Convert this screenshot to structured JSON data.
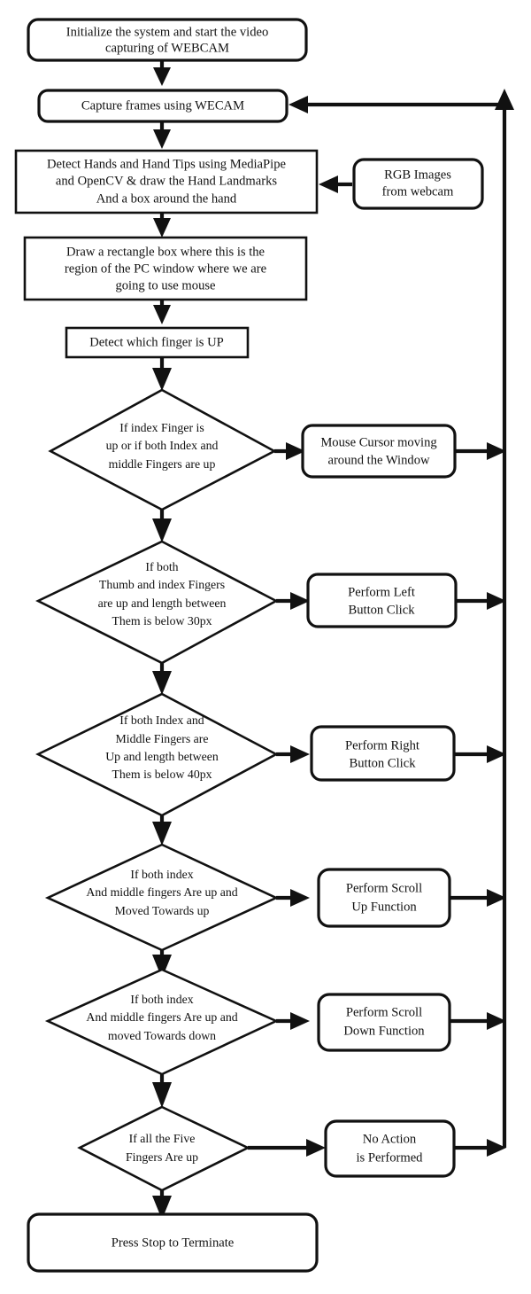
{
  "diagram": {
    "type": "flowchart",
    "title": "Virtual Mouse Hand Gesture Flowchart",
    "colors": {
      "stroke": "#111111",
      "fill": "#ffffff",
      "background": "#ffffff"
    },
    "nodes": [
      {
        "id": "start",
        "shape": "rounded-rect",
        "lines": [
          "Initialize the system and start the video",
          "capturing of WEBCAM"
        ]
      },
      {
        "id": "capture",
        "shape": "rounded-rect",
        "lines": [
          "Capture frames using WECAM"
        ]
      },
      {
        "id": "detect-hands",
        "shape": "rect",
        "lines": [
          "Detect Hands and Hand Tips using MediaPipe",
          "and OpenCV & draw the Hand Landmarks",
          "And a box around the hand"
        ]
      },
      {
        "id": "rgb-images",
        "shape": "rounded-rect",
        "lines": [
          "RGB Images",
          "from webcam"
        ]
      },
      {
        "id": "draw-rectangle",
        "shape": "rect",
        "lines": [
          "Draw a rectangle box where this is the",
          "region of the PC window where we are",
          "going to use mouse"
        ]
      },
      {
        "id": "detect-finger-up",
        "shape": "rect",
        "lines": [
          "Detect which finger is UP"
        ]
      },
      {
        "id": "decision-cursor",
        "shape": "diamond",
        "lines": [
          "If index Finger is",
          "up or if both Index and",
          "middle Fingers are up"
        ]
      },
      {
        "id": "action-cursor",
        "shape": "rounded-rect",
        "lines": [
          "Mouse Cursor moving",
          "around the Window"
        ]
      },
      {
        "id": "decision-left-click",
        "shape": "diamond",
        "lines": [
          "If both",
          "Thumb and index Fingers",
          "are up and length between",
          "Them is below 30px"
        ]
      },
      {
        "id": "action-left-click",
        "shape": "rounded-rect",
        "lines": [
          "Perform Left",
          "Button Click"
        ]
      },
      {
        "id": "decision-right-click",
        "shape": "diamond",
        "lines": [
          "If both Index and",
          "Middle Fingers are",
          "Up and length between",
          "Them is below 40px"
        ]
      },
      {
        "id": "action-right-click",
        "shape": "rounded-rect",
        "lines": [
          "Perform Right",
          "Button Click"
        ]
      },
      {
        "id": "decision-scroll-up",
        "shape": "diamond",
        "lines": [
          "If both index",
          "And middle fingers Are up and",
          "Moved Towards up"
        ]
      },
      {
        "id": "action-scroll-up",
        "shape": "rounded-rect",
        "lines": [
          "Perform Scroll",
          "Up Function"
        ]
      },
      {
        "id": "decision-scroll-down",
        "shape": "diamond",
        "lines": [
          "If both index",
          "And middle fingers Are up and",
          "moved Towards down"
        ]
      },
      {
        "id": "action-scroll-down",
        "shape": "rounded-rect",
        "lines": [
          "Perform Scroll",
          "Down Function"
        ]
      },
      {
        "id": "decision-five-fingers",
        "shape": "diamond",
        "lines": [
          "If all the Five",
          "Fingers Are up"
        ]
      },
      {
        "id": "action-no-action",
        "shape": "rounded-rect",
        "lines": [
          "No Action",
          "is Performed"
        ]
      },
      {
        "id": "terminate",
        "shape": "rounded-rect",
        "lines": [
          "Press Stop to Terminate"
        ]
      }
    ],
    "labels": {
      "start_l1": "Initialize the system and start the video",
      "start_l2": "capturing of WEBCAM",
      "capture_l1": "Capture frames using WECAM",
      "detect_hands_l1": "Detect Hands and Hand Tips using MediaPipe",
      "detect_hands_l2": "and OpenCV & draw the Hand Landmarks",
      "detect_hands_l3": "And a box around the hand",
      "rgb_l1": "RGB Images",
      "rgb_l2": "from webcam",
      "draw_rect_l1": "Draw a rectangle box where this is the",
      "draw_rect_l2": "region of the PC window where we are",
      "draw_rect_l3": "going to use mouse",
      "detect_up_l1": "Detect which finger is UP",
      "d_cursor_l1": "If index Finger is",
      "d_cursor_l2": "up or if both Index and",
      "d_cursor_l3": "middle Fingers are up",
      "a_cursor_l1": "Mouse Cursor moving",
      "a_cursor_l2": "around the Window",
      "d_left_l1": "If both",
      "d_left_l2": "Thumb and index Fingers",
      "d_left_l3": "are up and length between",
      "d_left_l4": "Them is below 30px",
      "a_left_l1": "Perform Left",
      "a_left_l2": "Button Click",
      "d_right_l1": "If both Index and",
      "d_right_l2": "Middle Fingers are",
      "d_right_l3": "Up and length between",
      "d_right_l4": "Them is below 40px",
      "a_right_l1": "Perform Right",
      "a_right_l2": "Button Click",
      "d_sup_l1": "If both index",
      "d_sup_l2": "And middle fingers Are up and",
      "d_sup_l3": "Moved Towards up",
      "a_sup_l1": "Perform Scroll",
      "a_sup_l2": "Up Function",
      "d_sdn_l1": "If both index",
      "d_sdn_l2": "And middle fingers Are up and",
      "d_sdn_l3": "moved Towards down",
      "a_sdn_l1": "Perform Scroll",
      "a_sdn_l2": "Down Function",
      "d_five_l1": "If all the Five",
      "d_five_l2": "Fingers Are up",
      "a_none_l1": "No Action",
      "a_none_l2": "is Performed",
      "terminate_l1": "Press Stop to Terminate"
    }
  }
}
